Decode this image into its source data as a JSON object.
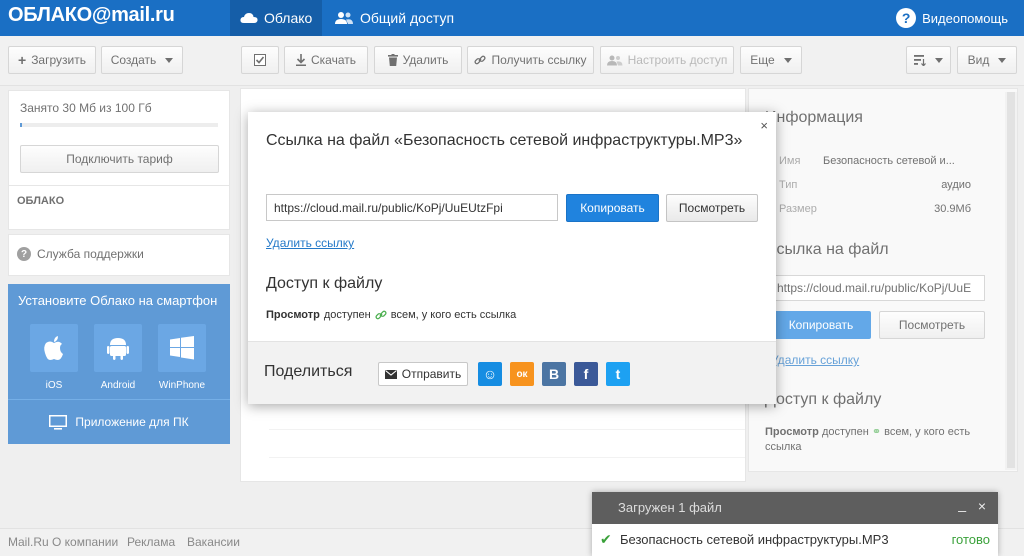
{
  "header": {
    "logo_text": "ОБЛАКО@mail.ru",
    "tabs": [
      {
        "label": "Облако",
        "active": true
      },
      {
        "label": "Общий доступ",
        "active": false
      }
    ],
    "help_label": "Видеопомощь"
  },
  "toolbar": {
    "upload_label": "Загрузить",
    "create_label": "Создать",
    "download_label": "Скачать",
    "delete_label": "Удалить",
    "get_link_label": "Получить ссылку",
    "setup_access_label": "Настроить доступ",
    "more_label": "Еще",
    "view_label": "Вид"
  },
  "sidebar": {
    "quota_text": "Занято 30 Мб из 100 Гб",
    "quota_fraction": 0.0003,
    "tariff_button": "Подключить тариф",
    "cloud_label": "ОБЛАКО",
    "support_label": "Служба поддержки",
    "mobile": {
      "title": "Установите Облако на смартфон",
      "platforms": [
        {
          "label": "iOS",
          "icon": "apple-icon"
        },
        {
          "label": "Android",
          "icon": "android-icon"
        },
        {
          "label": "WinPhone",
          "icon": "windows-icon"
        }
      ],
      "pc_app_label": "Приложение для ПК"
    }
  },
  "info_panel": {
    "title": "Информация",
    "name_label": "Имя",
    "name_value": "Безопасность сетевой и...",
    "type_label": "Тип",
    "type_value": "аудио",
    "size_label": "Размер",
    "size_value": "30.9Мб",
    "link_title": "Ссылка на файл",
    "link_value": "https://cloud.mail.ru/public/KoPj/UuE",
    "copy_label": "Копировать",
    "view_label": "Посмотреть",
    "delete_link_label": "Удалить ссылку",
    "access_title": "Доступ к файлу",
    "access_bold": "Просмотр",
    "access_text": "доступен",
    "access_rest": "всем, у кого есть ссылка"
  },
  "modal": {
    "title": "Ссылка на файл «Безопасность сетевой инфраструктуры.MP3»",
    "close_glyph": "×",
    "link_value": "https://cloud.mail.ru/public/KoPj/UuEUtzFpi",
    "copy_label": "Копировать",
    "view_label": "Посмотреть",
    "delete_link_label": "Удалить ссылку",
    "access_title": "Доступ к файлу",
    "access_bold": "Просмотр",
    "access_text": "доступен",
    "access_rest": "всем, у кого есть ссылка",
    "share_label": "Поделиться",
    "send_label": "Отправить",
    "social": [
      {
        "name": "mailru-moi-mir",
        "color": "#168de2",
        "glyph": "☺"
      },
      {
        "name": "odnoklassniki",
        "color": "#f7931e",
        "glyph": "ок"
      },
      {
        "name": "vkontakte",
        "color": "#4c75a3",
        "glyph": "В"
      },
      {
        "name": "facebook",
        "color": "#3b5998",
        "glyph": "f"
      },
      {
        "name": "twitter",
        "color": "#1da1f2",
        "glyph": "t"
      }
    ]
  },
  "footer": {
    "links": [
      "Mail.Ru",
      "О компании",
      "Реклама",
      "Вакансии"
    ]
  },
  "upload_toast": {
    "title": "Загружен 1 файл",
    "minimize_glyph": "_",
    "close_glyph": "×",
    "file_name": "Безопасность сетевой инфраструктуры.MP3",
    "status": "готово"
  }
}
